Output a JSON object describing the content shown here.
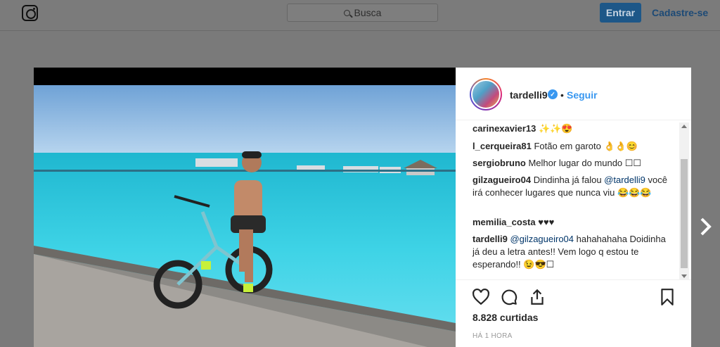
{
  "topbar": {
    "logo_icon": "instagram-icon",
    "search_placeholder": "Busca",
    "login_label": "Entrar",
    "signup_label": "Cadastre-se"
  },
  "post": {
    "username": "tardelli9",
    "follow_label": "Seguir",
    "separator": "•",
    "likes": "8.828 curtidas",
    "time": "HÁ 1 HORA"
  },
  "comments": [
    {
      "user": "carinexavier13",
      "text": "✨✨😍"
    },
    {
      "user": "l_cerqueira81",
      "text": "Fotão em garoto 👌👌😊"
    },
    {
      "user": "sergiobruno",
      "text": "Melhor lugar do mundo ☐☐"
    },
    {
      "user": "gilzagueiro04",
      "pre": "Dindinha já falou ",
      "mention": "@tardelli9",
      "post": " você irá conhecer lugares que nunca viu 😂😂😂"
    },
    {
      "user": "memilia_costa",
      "text": "♥♥♥"
    },
    {
      "user": "tardelli9",
      "pre": "",
      "mention": "@gilzagueiro04",
      "post": " hahahahaha Doidinha já deu a letra antes!! Vem logo q estou te esperando!! 😉😎☐"
    }
  ],
  "colors": {
    "accent": "#3897f0",
    "login_button": "#1d5788",
    "overlay": "#7a7a7a"
  }
}
